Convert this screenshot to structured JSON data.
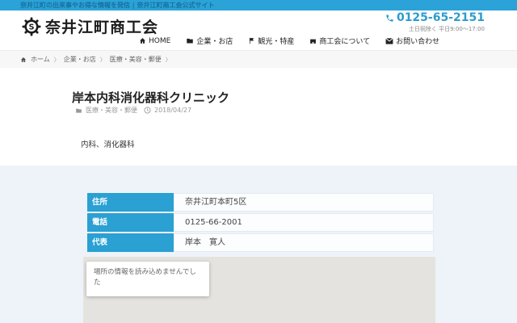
{
  "topbar": {
    "tagline": "奈井江町の出来事やお得な情報を発信 | 奈井江町商工会公式サイト"
  },
  "header": {
    "site_title": "奈井江町商工会",
    "phone": {
      "number": "0125-65-2151",
      "hours": "土日祝除く 平日9:00〜17:00"
    },
    "nav": [
      {
        "icon": "home-icon",
        "label": "HOME"
      },
      {
        "icon": "folder-icon",
        "label": "企業・お店"
      },
      {
        "icon": "flag-icon",
        "label": "観光・特産"
      },
      {
        "icon": "building-icon",
        "label": "商工会について"
      },
      {
        "icon": "mail-icon",
        "label": "お問い合わせ"
      }
    ]
  },
  "breadcrumb": {
    "separator": "〉",
    "items": [
      "ホーム",
      "企業・お店",
      "医療・美容・郵便"
    ]
  },
  "article": {
    "title": "岸本内科消化器科クリニック",
    "category": "医療・美容・郵便",
    "date": "2018/04/27",
    "description": "内科、消化器科",
    "details": [
      {
        "label": "住所",
        "value": "奈井江町本町5区"
      },
      {
        "label": "電話",
        "value": "0125-66-2001"
      },
      {
        "label": "代表",
        "value": "岸本　寛人"
      }
    ],
    "map_error": "場所の情報を読み込めませんでした"
  },
  "colors": {
    "accent_blue": "#2ba2d8",
    "phone_blue": "#2b9ccd",
    "table_header_blue": "#2aa0d3",
    "section_bg": "#edf3f8",
    "map_bg": "#e5e3df"
  }
}
